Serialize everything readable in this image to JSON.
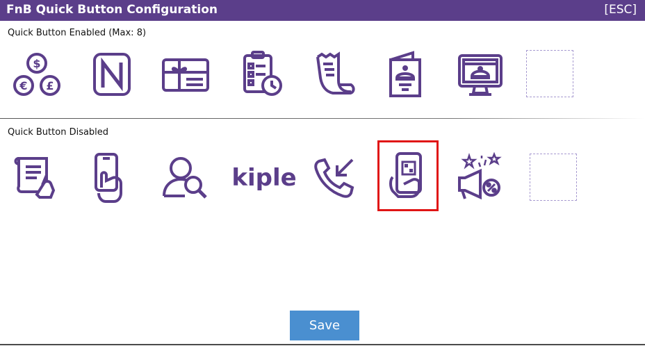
{
  "window": {
    "title": "FnB Quick Button Configuration",
    "esc_label": "[ESC]"
  },
  "enabled_section": {
    "label": "Quick Button Enabled (Max: 8)",
    "buttons": [
      {
        "icon": "currency-coins-icon"
      },
      {
        "icon": "nfc-icon"
      },
      {
        "icon": "gift-card-icon"
      },
      {
        "icon": "checklist-clock-icon"
      },
      {
        "icon": "receipt-icon"
      },
      {
        "icon": "menu-book-icon"
      },
      {
        "icon": "online-menu-monitor-icon"
      },
      {
        "icon": "empty-slot"
      }
    ]
  },
  "disabled_section": {
    "label": "Quick Button Disabled",
    "buttons": [
      {
        "icon": "document-sign-icon"
      },
      {
        "icon": "phone-hand-icon"
      },
      {
        "icon": "member-search-icon"
      },
      {
        "icon": "kiple-logo",
        "text": "kiple"
      },
      {
        "icon": "incoming-call-icon"
      },
      {
        "icon": "qr-phone-hand-icon",
        "selected": true
      },
      {
        "icon": "promotion-megaphone-icon"
      },
      {
        "icon": "empty-slot"
      }
    ]
  },
  "actions": {
    "save_label": "Save"
  },
  "colors": {
    "titlebar": "#5b3e8a",
    "icon": "#5b3e8a",
    "selection": "#e01515",
    "save_button": "#4a8fd0",
    "empty_slot_border": "#a79ad0"
  }
}
